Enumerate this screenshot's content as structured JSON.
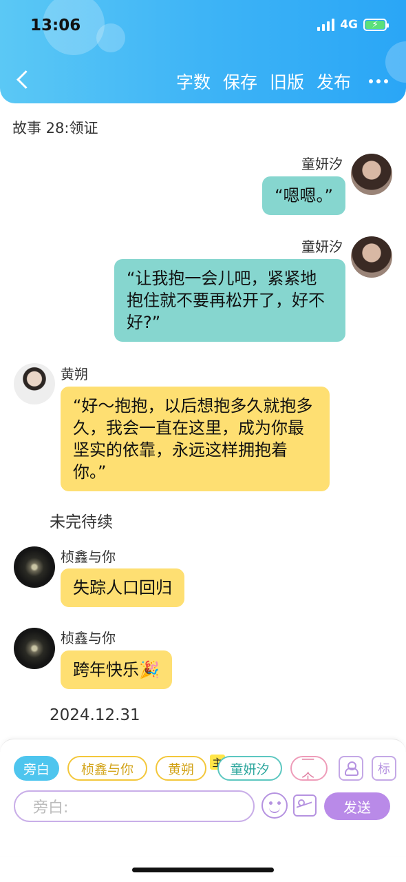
{
  "status_bar": {
    "time": "13:06",
    "network": "4G"
  },
  "header": {
    "nav_actions": [
      "字数",
      "保存",
      "旧版",
      "发布"
    ],
    "icons": {
      "back": "chevron-left-icon",
      "more": "more-horizontal-icon"
    }
  },
  "story_title": "故事 28:领证",
  "messages": [
    {
      "sender": "童妍汐",
      "side": "right",
      "text": "“嗯嗯。”",
      "color": "#86d6cf"
    },
    {
      "sender": "童妍汐",
      "side": "right",
      "text": "“让我抱一会儿吧，紧紧地抱住就不要再松开了，好不好?”",
      "color": "#86d6cf"
    },
    {
      "sender": "黄朔",
      "side": "left",
      "text": "“好～抱抱，以后想抱多久就抱多久，我会一直在这里，成为你最坚实的依靠，永远这样拥抱着你。”",
      "color": "#fedf72"
    },
    {
      "narration": "未完待续"
    },
    {
      "sender": "桢鑫与你",
      "side": "left",
      "text": "失踪人口回归",
      "color": "#fedf72"
    },
    {
      "sender": "桢鑫与你",
      "side": "left",
      "text": "跨年快乐🎉",
      "color": "#fedf72"
    },
    {
      "narration": "2024.12.31"
    }
  ],
  "composer": {
    "chips": [
      "旁白",
      "桢鑫与你",
      "黄朔",
      "童妍汐",
      "一个"
    ],
    "main_badge": "主",
    "tag_button": "标",
    "input_placeholder": "旁白:",
    "send_label": "发送"
  },
  "colors": {
    "header_gradient": [
      "#5bc8f5",
      "#2aa6f6"
    ],
    "teal_bubble": "#86d6cf",
    "yellow_bubble": "#fedf72",
    "accent_purple": "#b98ae8"
  }
}
